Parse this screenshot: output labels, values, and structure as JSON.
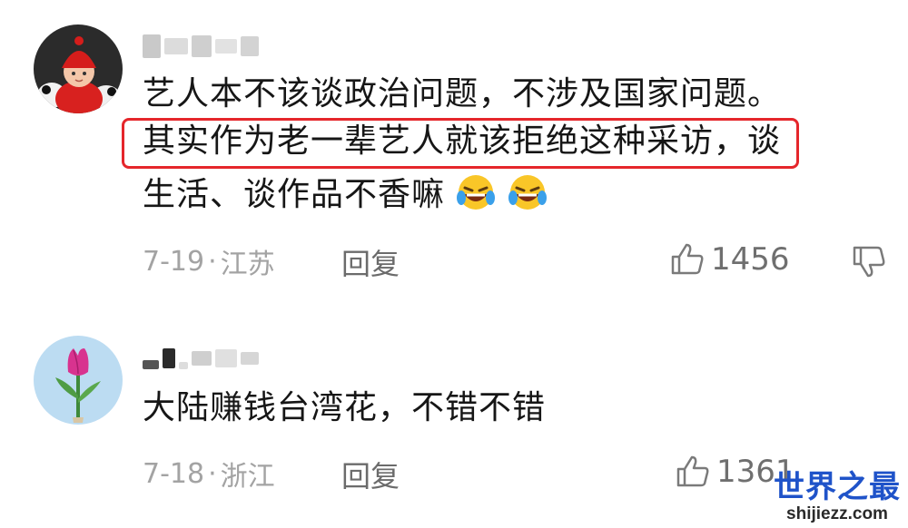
{
  "comments": [
    {
      "avatar": "baby-in-red-hat-avatar",
      "text_lines": [
        "艺人本不该谈政治问题，不涉及国家问题。",
        "其实作为老一辈艺人就该拒绝这种采访，谈",
        "生活、谈作品不香嘛"
      ],
      "highlighted": "其实作为老一辈艺人就该拒绝这种采访，",
      "emojis": [
        "laughing-crying-emoji",
        "laughing-crying-emoji"
      ],
      "date": "7-19",
      "location": "江苏",
      "reply_label": "回复",
      "likes": "1456"
    },
    {
      "avatar": "tulip-avatar",
      "text_lines": [
        "大陆赚钱台湾花，不错不错"
      ],
      "date": "7-18",
      "location": "浙江",
      "reply_label": "回复",
      "likes": "1361"
    }
  ],
  "meta_separator": "·",
  "watermark": {
    "title": "世界之最",
    "url": "shijiezz.com"
  },
  "colors": {
    "highlight_border": "#e5262b",
    "watermark_blue": "#1f53c9",
    "meta_gray": "#a3a3a3"
  }
}
